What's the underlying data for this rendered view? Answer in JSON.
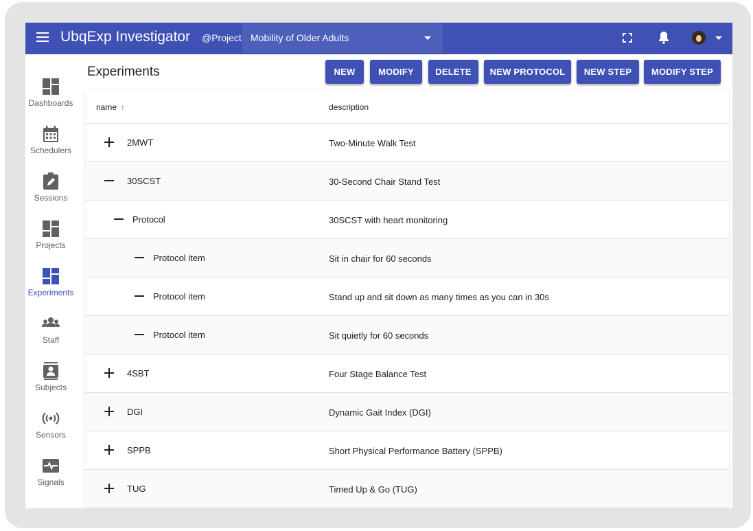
{
  "app": {
    "title": "UbqExp Investigator",
    "project_label": "@Project",
    "project_selected": "Mobility of Older Adults"
  },
  "topbar_icons": [
    "menu-icon",
    "fullscreen-icon",
    "bell-icon",
    "avatar",
    "chevron-down-icon"
  ],
  "sidebar": {
    "items": [
      {
        "label": "Dashboards",
        "icon": "dashboard-icon"
      },
      {
        "label": "Schedulers",
        "icon": "calendar-icon"
      },
      {
        "label": "Sessions",
        "icon": "clipboard-edit-icon"
      },
      {
        "label": "Projects",
        "icon": "dashboard-icon"
      },
      {
        "label": "Experiments",
        "icon": "dashboard-icon",
        "active": true
      },
      {
        "label": "Staff",
        "icon": "group-icon"
      },
      {
        "label": "Subjects",
        "icon": "contact-card-icon"
      },
      {
        "label": "Sensors",
        "icon": "sensor-signal-icon"
      },
      {
        "label": "Signals",
        "icon": "monitor-heart-icon"
      }
    ]
  },
  "page": {
    "title": "Experiments",
    "buttons": {
      "new": "NEW",
      "modify": "MODIFY",
      "delete": "DELETE",
      "new_protocol": "NEW PROTOCOL",
      "new_step": "NEW STEP",
      "modify_step": "MODIFY STEP"
    }
  },
  "table": {
    "headers": {
      "name": "name",
      "description": "description"
    },
    "sort_icon": "arrow-up-icon",
    "rows": [
      {
        "toggle": "+",
        "name": "2MWT",
        "description": "Two-Minute Walk Test",
        "level": 0
      },
      {
        "toggle": "—",
        "name": "30SCST",
        "description": "30-Second Chair Stand Test",
        "level": 0
      },
      {
        "toggle": "—",
        "name": "Protocol",
        "description": "30SCST with heart monitoring",
        "level": 1
      },
      {
        "toggle": "—",
        "name": "Protocol item",
        "description": "Sit in chair for 60 seconds",
        "level": 2
      },
      {
        "toggle": "—",
        "name": "Protocol item",
        "description": "Stand up and sit down as many times as you can in 30s",
        "level": 2
      },
      {
        "toggle": "—",
        "name": "Protocol item",
        "description": "Sit quietly for 60 seconds",
        "level": 2
      },
      {
        "toggle": "+",
        "name": "4SBT",
        "description": "Four Stage Balance Test",
        "level": 0
      },
      {
        "toggle": "+",
        "name": "DGI",
        "description": "Dynamic Gait Index (DGI)",
        "level": 0
      },
      {
        "toggle": "+",
        "name": "SPPB",
        "description": "Short Physical Performance Battery (SPPB)",
        "level": 0
      },
      {
        "toggle": "+",
        "name": "TUG",
        "description": "Timed Up & Go (TUG)",
        "level": 0
      }
    ]
  },
  "colors": {
    "primary": "#3f51b5",
    "select_bg": "#4d5ebb",
    "frame": "#e4e4e4"
  }
}
